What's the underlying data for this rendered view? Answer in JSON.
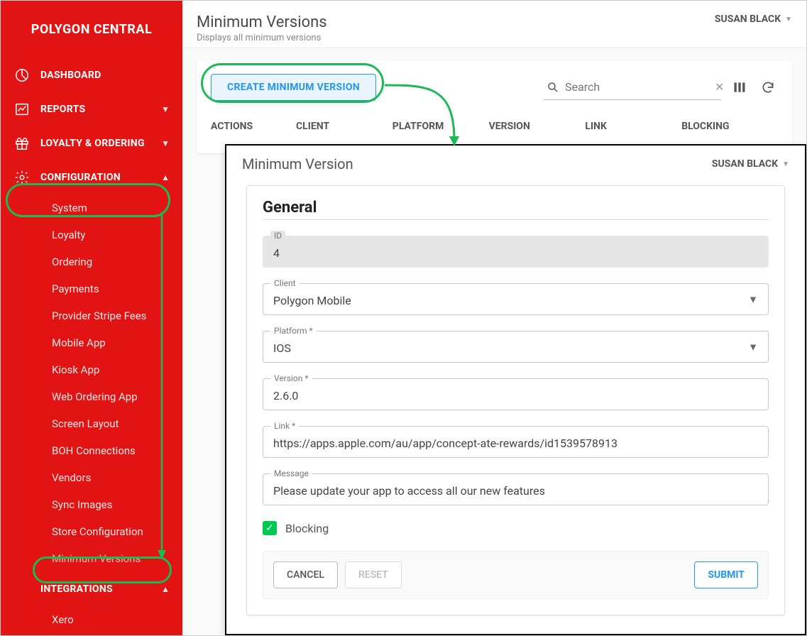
{
  "brand": "POLYGON CENTRAL",
  "user": "SUSAN BLACK",
  "sidebar": {
    "dashboard": "DASHBOARD",
    "reports": "REPORTS",
    "loyalty_ordering": "LOYALTY & ORDERING",
    "configuration": "CONFIGURATION",
    "integrations": "INTEGRATIONS",
    "config_items": {
      "system": "System",
      "loyalty": "Loyalty",
      "ordering": "Ordering",
      "payments": "Payments",
      "provider_stripe_fees": "Provider Stripe Fees",
      "mobile_app": "Mobile App",
      "kiosk_app": "Kiosk App",
      "web_ordering_app": "Web Ordering App",
      "screen_layout": "Screen Layout",
      "boh_connections": "BOH Connections",
      "vendors": "Vendors",
      "sync_images": "Sync Images",
      "store_configuration": "Store Configuration",
      "minimum_versions": "Minimum Versions"
    },
    "integrations_items": {
      "xero": "Xero"
    }
  },
  "page": {
    "title": "Minimum Versions",
    "subtitle": "Displays all minimum versions"
  },
  "create_button": "CREATE MINIMUM VERSION",
  "search_placeholder": "Search",
  "columns": {
    "actions": "ACTIONS",
    "client": "CLIENT",
    "platform": "PLATFORM",
    "version": "VERSION",
    "link": "LINK",
    "blocking": "BLOCKING"
  },
  "modal": {
    "title": "Minimum Version",
    "general": "General",
    "labels": {
      "id": "ID",
      "client": "Client",
      "platform": "Platform *",
      "version": "Version *",
      "link": "Link *",
      "message": "Message",
      "blocking": "Blocking"
    },
    "values": {
      "id": "4",
      "client": "Polygon Mobile",
      "platform": "IOS",
      "version": "2.6.0",
      "link": "https://apps.apple.com/au/app/concept-ate-rewards/id1539578913",
      "message": "Please update your app to access all our new features"
    },
    "buttons": {
      "cancel": "CANCEL",
      "reset": "RESET",
      "submit": "SUBMIT"
    }
  }
}
